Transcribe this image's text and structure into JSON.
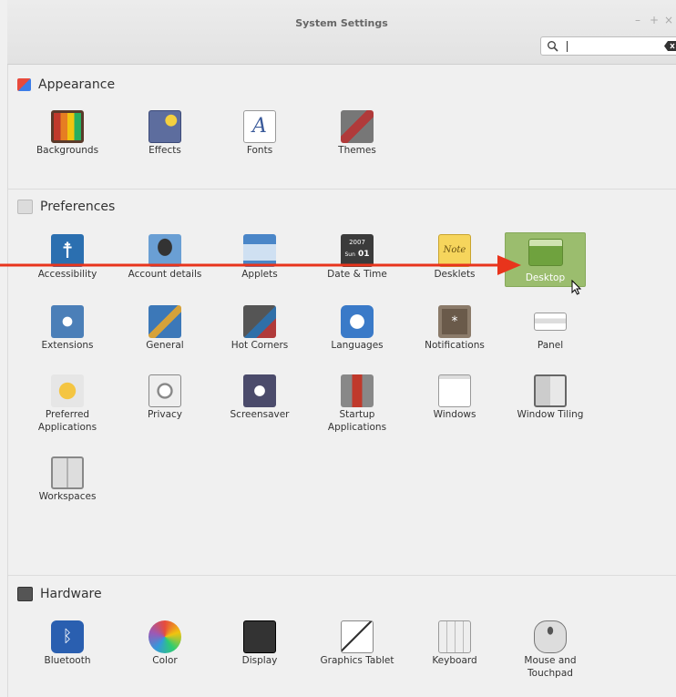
{
  "window": {
    "title": "System Settings",
    "minimize": "–",
    "maximize": "+",
    "close": "×"
  },
  "search": {
    "value": ""
  },
  "sections": {
    "appearance": {
      "title": "Appearance",
      "items": [
        "Backgrounds",
        "Effects",
        "Fonts",
        "Themes"
      ]
    },
    "preferences": {
      "title": "Preferences",
      "items": [
        "Accessibility",
        "Account details",
        "Applets",
        "Date & Time",
        "Desklets",
        "Desktop",
        "Extensions",
        "General",
        "Hot Corners",
        "Languages",
        "Notifications",
        "Panel",
        "Preferred Applications",
        "Privacy",
        "Screensaver",
        "Startup Applications",
        "Windows",
        "Window Tiling",
        "Workspaces"
      ],
      "selected": "Desktop"
    },
    "hardware": {
      "title": "Hardware",
      "items": [
        "Bluetooth",
        "Color",
        "Display",
        "Graphics Tablet",
        "Keyboard",
        "Mouse and Touchpad"
      ]
    }
  },
  "icons": {
    "date_year": "2007",
    "date_day": "01",
    "date_weekday": "Sun",
    "desklet_sign": "Note"
  },
  "colors": {
    "selection": "#9bbd6e",
    "annotation_arrow": "#e8341c"
  }
}
